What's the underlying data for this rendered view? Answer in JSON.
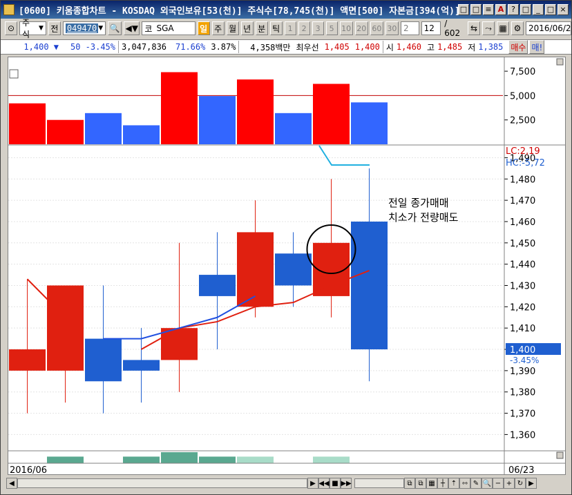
{
  "window": {
    "title": "[0600] 키움종합차트 - KOSDAQ 외국인보유[53(천)] 주식수[78,745(천)] 액면[500] 자본금[394(억)] 결",
    "title_buttons": [
      "□",
      "□",
      "≡",
      "A",
      "?",
      "□",
      "_",
      "□",
      "×"
    ]
  },
  "toolbar": {
    "market_type": "주식",
    "prefix": "전",
    "stock_code": "049470",
    "exchange_tag": "코",
    "stock_name": "SGA",
    "period_day": "일",
    "period_week": "주",
    "period_month": "월",
    "period_year": "년",
    "period_minute": "분",
    "period_tick": "틱",
    "tick_options": [
      "1",
      "2",
      "3",
      "5",
      "10",
      "20",
      "60",
      "30",
      "2"
    ],
    "count_value": "12",
    "count_total": "/ 602",
    "date_value": "2016/06/2"
  },
  "quote": {
    "price": "1,400 ▼",
    "change": "50 -3.45%",
    "volume": "3,047,836",
    "ratio1": "71.66%",
    "ratio2": "3.87%",
    "amount": "4,358백만",
    "best_label": "최우선",
    "best_ask": "1,405",
    "best_bid": "1,400",
    "open_label": "시",
    "open": "1,460",
    "high_label": "고",
    "high": "1,485",
    "low_label": "저",
    "low": "1,385",
    "buy_label": "매수",
    "sell_label": "매!"
  },
  "chart_data": [
    {
      "type": "bar",
      "panel": "volume",
      "ylim": [
        0,
        8500
      ],
      "y_ticks": [
        2500,
        5000,
        7500
      ],
      "y_tick_labels": [
        "2,500",
        "5,000",
        "7,500"
      ],
      "reference_line": 5000,
      "bars": [
        {
          "value": 4200,
          "color": "#ff0000"
        },
        {
          "value": 2500,
          "color": "#ff0000"
        },
        {
          "value": 3200,
          "color": "#3366ff"
        },
        {
          "value": 1950,
          "color": "#3366ff"
        },
        {
          "value": 7400,
          "color": "#ff0000"
        },
        {
          "value": 4950,
          "color": "#3366ff"
        },
        {
          "value": 6650,
          "color": "#ff0000"
        },
        {
          "value": 3200,
          "color": "#3366ff"
        },
        {
          "value": 6200,
          "color": "#ff0000"
        },
        {
          "value": 4300,
          "color": "#3366ff"
        }
      ]
    },
    {
      "type": "candlestick",
      "panel": "price",
      "ylim": [
        1353,
        1495
      ],
      "y_ticks": [
        1360,
        1370,
        1380,
        1390,
        1400,
        1410,
        1420,
        1430,
        1440,
        1450,
        1460,
        1470,
        1480,
        1490
      ],
      "y_tick_labels": [
        "1,360",
        "1,370",
        "1,380",
        "1,390",
        "1,400",
        "1,410",
        "1,420",
        "1,430",
        "1,440",
        "1,450",
        "1,460",
        "1,470",
        "1,480",
        "1,490"
      ],
      "legend": {
        "lc": "LC:2,19",
        "hc": "HC:-5,72"
      },
      "current_price_label": "1,400",
      "current_change_label": "-3.45%",
      "current_price": 1400,
      "candles": [
        {
          "open": 1390,
          "high": 1433,
          "low": 1370,
          "close": 1400,
          "up": true
        },
        {
          "open": 1390,
          "high": 1430,
          "low": 1375,
          "close": 1430,
          "up": true
        },
        {
          "open": 1405,
          "high": 1430,
          "low": 1370,
          "close": 1385,
          "up": false
        },
        {
          "open": 1395,
          "high": 1410,
          "low": 1375,
          "close": 1390,
          "up": false
        },
        {
          "open": 1395,
          "high": 1450,
          "low": 1380,
          "close": 1410,
          "up": true
        },
        {
          "open": 1435,
          "high": 1455,
          "low": 1400,
          "close": 1425,
          "up": false
        },
        {
          "open": 1420,
          "high": 1470,
          "low": 1415,
          "close": 1455,
          "up": true
        },
        {
          "open": 1445,
          "high": 1455,
          "low": 1420,
          "close": 1430,
          "up": false
        },
        {
          "open": 1425,
          "high": 1480,
          "low": 1415,
          "close": 1450,
          "up": true
        },
        {
          "open": 1460,
          "high": 1485,
          "low": 1385,
          "close": 1400,
          "up": false
        }
      ],
      "red_line": [
        1433,
        1415,
        null,
        1400,
        1410,
        1413,
        1420,
        1422,
        1430,
        1437
      ],
      "blue_line": [
        null,
        null,
        1405,
        1405,
        1410,
        1415,
        1425,
        null,
        null,
        null
      ],
      "annotation": [
        "전일 종가매매",
        "치소가 전량매도"
      ]
    },
    {
      "type": "bar",
      "panel": "sub-indicator",
      "bars": [
        {
          "value": 0,
          "color": "#5aa890"
        },
        {
          "value": 0.6,
          "color": "#5aa890"
        },
        {
          "value": 0,
          "color": "#5aa890"
        },
        {
          "value": 0.6,
          "color": "#5aa890"
        },
        {
          "value": 1.0,
          "color": "#5aa890"
        },
        {
          "value": 0.6,
          "color": "#5aa890"
        },
        {
          "value": 0.6,
          "color": "#a8dcc8"
        },
        {
          "value": 0,
          "color": "#a8dcc8"
        },
        {
          "value": 0.6,
          "color": "#a8dcc8"
        },
        {
          "value": 0,
          "color": "#a8dcc8"
        }
      ]
    }
  ],
  "axis": {
    "date_left": "2016/06",
    "date_right": "06/23"
  },
  "colors": {
    "up": "#e02010",
    "down": "#1f5fd0",
    "volume_up": "#ff0000",
    "volume_down": "#3366ff",
    "red_ma": "#e02010",
    "blue_ma": "#2050e0",
    "indicator_line": "#20b0e0",
    "ref_line": "#c00000"
  },
  "indicator_line": [
    null,
    null,
    null,
    null,
    null,
    null,
    null,
    null,
    1,
    0
  ]
}
